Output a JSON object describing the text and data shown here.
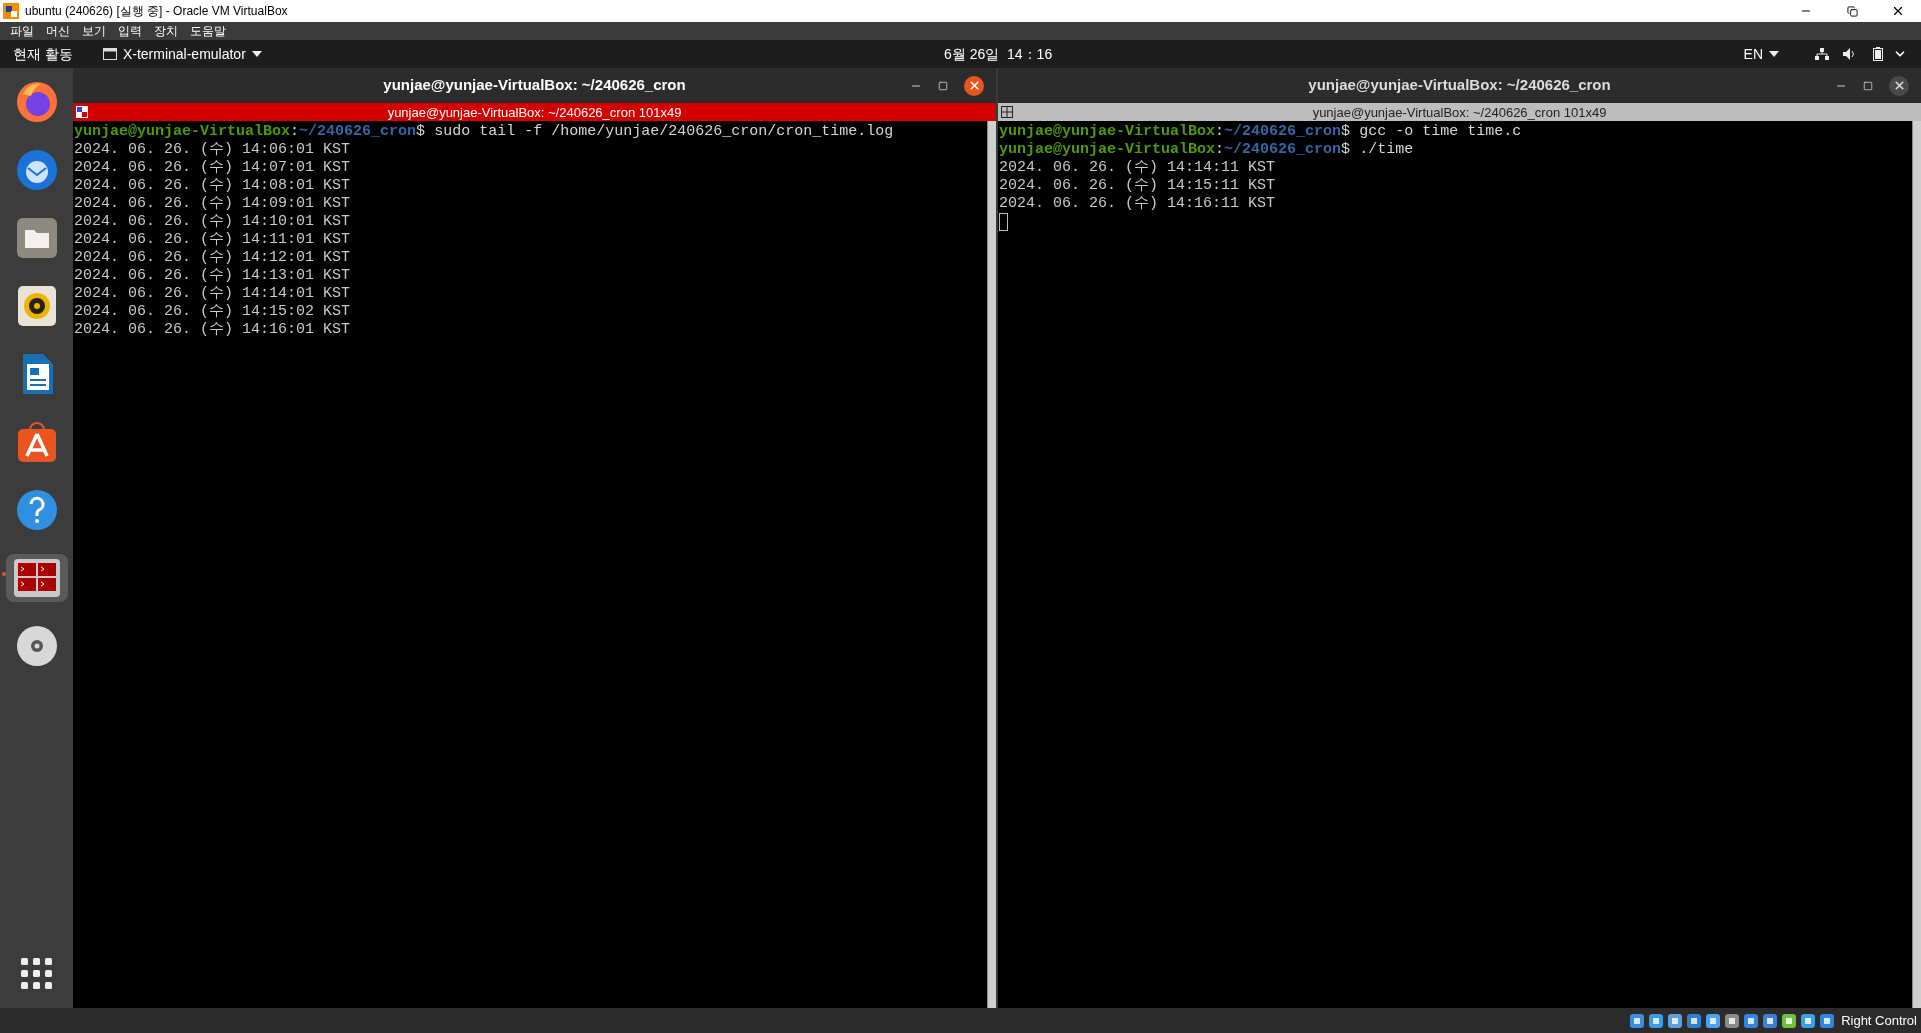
{
  "vbox": {
    "title": "ubuntu (240626) [실행 중] - Oracle VM VirtualBox",
    "menu": [
      "파일",
      "머신",
      "보기",
      "입력",
      "장치",
      "도움말"
    ]
  },
  "topbar": {
    "activities": "현재 활동",
    "app_menu": "X-terminal-emulator",
    "clock": "6월 26일  14：16",
    "language": "EN"
  },
  "dock": [
    {
      "kind": "firefox",
      "running": false
    },
    {
      "kind": "thunderbird",
      "running": false
    },
    {
      "kind": "files",
      "running": false
    },
    {
      "kind": "rhythmbox",
      "running": false
    },
    {
      "kind": "writer",
      "running": false
    },
    {
      "kind": "software",
      "running": false
    },
    {
      "kind": "help",
      "running": false
    },
    {
      "kind": "terminal",
      "running": true
    },
    {
      "kind": "disc",
      "running": false
    }
  ],
  "terminals": [
    {
      "title": "yunjae@yunjae-VirtualBox: ~/240626_cron",
      "focused": true,
      "tab_title": "yunjae@yunjae-VirtualBox: ~/240626_cron 101x49",
      "cursor": false,
      "lines": [
        {
          "kind": "prompt",
          "user": "yunjae@yunjae-VirtualBox",
          "sep": ":",
          "path": "~/240626_cron",
          "end": "$",
          "command": "sudo tail -f /home/yunjae/240626_cron/cron_time.log"
        },
        {
          "kind": "output",
          "text": "2024. 06. 26. (수) 14:06:01 KST"
        },
        {
          "kind": "output",
          "text": "2024. 06. 26. (수) 14:07:01 KST"
        },
        {
          "kind": "output",
          "text": "2024. 06. 26. (수) 14:08:01 KST"
        },
        {
          "kind": "output",
          "text": "2024. 06. 26. (수) 14:09:01 KST"
        },
        {
          "kind": "output",
          "text": "2024. 06. 26. (수) 14:10:01 KST"
        },
        {
          "kind": "output",
          "text": "2024. 06. 26. (수) 14:11:01 KST"
        },
        {
          "kind": "output",
          "text": "2024. 06. 26. (수) 14:12:01 KST"
        },
        {
          "kind": "output",
          "text": "2024. 06. 26. (수) 14:13:01 KST"
        },
        {
          "kind": "output",
          "text": "2024. 06. 26. (수) 14:14:01 KST"
        },
        {
          "kind": "output",
          "text": "2024. 06. 26. (수) 14:15:02 KST"
        },
        {
          "kind": "output",
          "text": "2024. 06. 26. (수) 14:16:01 KST"
        }
      ]
    },
    {
      "title": "yunjae@yunjae-VirtualBox: ~/240626_cron",
      "focused": false,
      "tab_title": "yunjae@yunjae-VirtualBox: ~/240626_cron 101x49",
      "cursor": true,
      "lines": [
        {
          "kind": "prompt",
          "user": "yunjae@yunjae-VirtualBox",
          "sep": ":",
          "path": "~/240626_cron",
          "end": "$",
          "command": "gcc -o time time.c"
        },
        {
          "kind": "prompt",
          "user": "yunjae@yunjae-VirtualBox",
          "sep": ":",
          "path": "~/240626_cron",
          "end": "$",
          "command": "./time"
        },
        {
          "kind": "output",
          "text": "2024. 06. 26. (수) 14:14:11 KST"
        },
        {
          "kind": "output",
          "text": "2024. 06. 26. (수) 14:15:11 KST"
        },
        {
          "kind": "output",
          "text": "2024. 06. 26. (수) 14:16:11 KST"
        }
      ]
    }
  ],
  "status_bar": {
    "host_key": "Right Control"
  }
}
